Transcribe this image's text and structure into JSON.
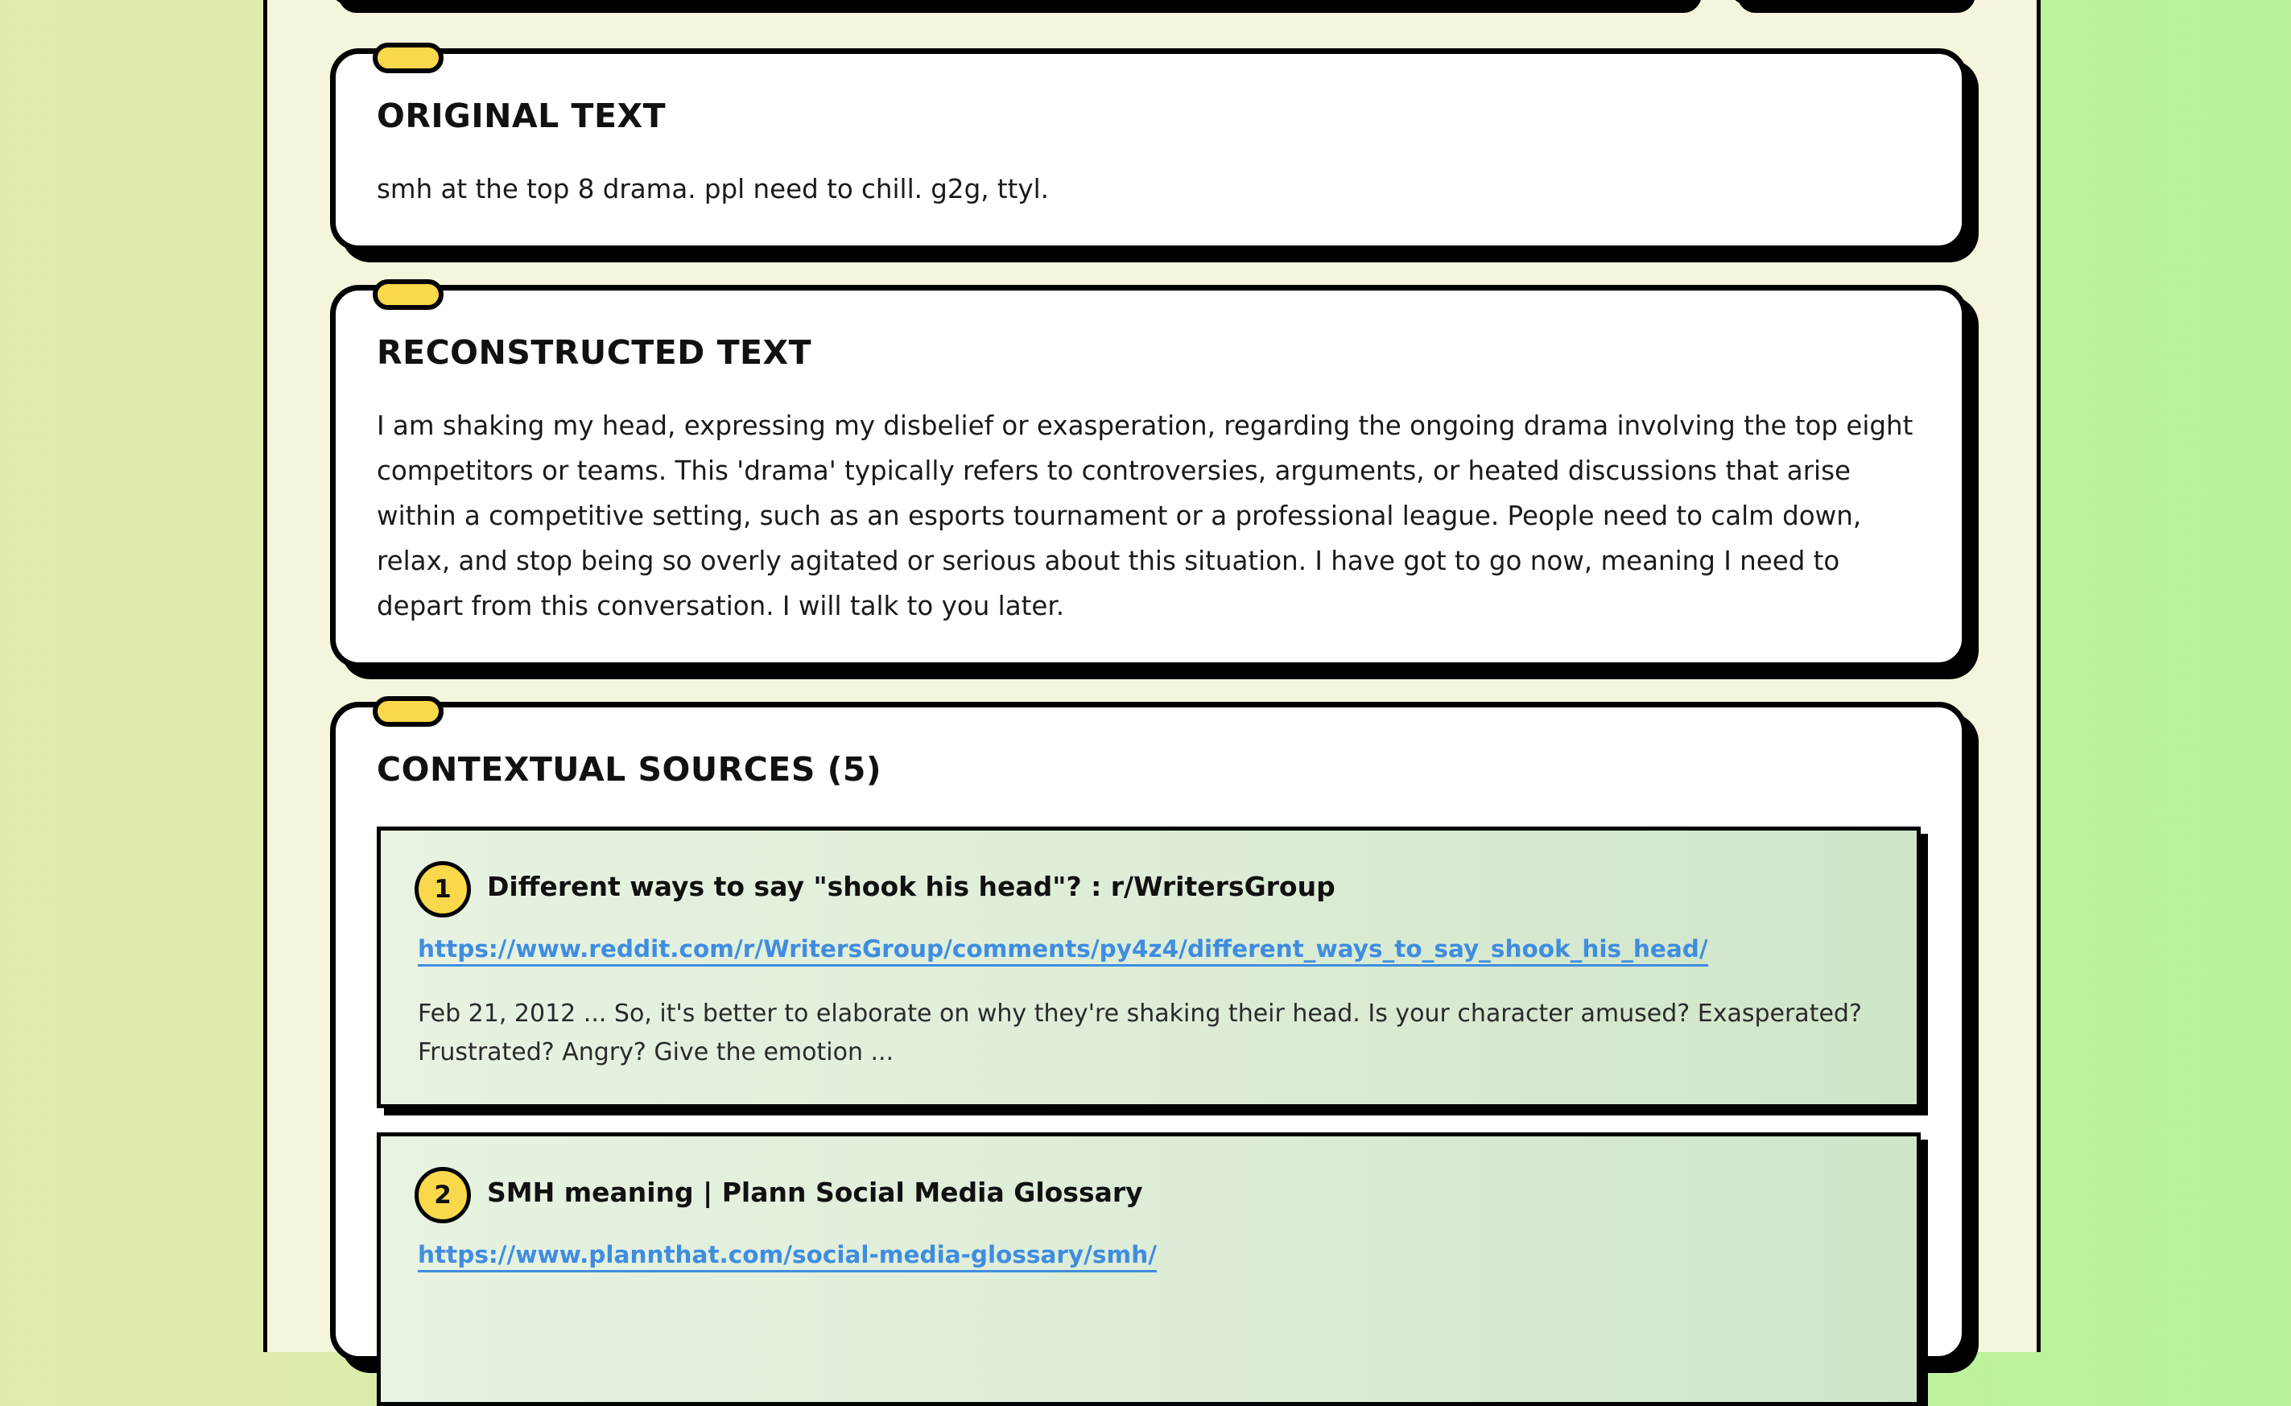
{
  "original_card": {
    "title": "ORIGINAL TEXT",
    "text": "smh at the top 8 drama. ppl need to chill. g2g, ttyl."
  },
  "reconstructed_card": {
    "title": "RECONSTRUCTED TEXT",
    "text": "I am shaking my head, expressing my disbelief or exasperation, regarding the ongoing drama involving the top eight competitors or teams. This 'drama' typically refers to controversies, arguments, or heated discussions that arise within a competitive setting, such as an esports tournament or a professional league. People need to calm down, relax, and stop being so overly agitated or serious about this situation. I have got to go now, meaning I need to depart from this conversation. I will talk to you later."
  },
  "sources_card": {
    "title": "CONTEXTUAL SOURCES (5)",
    "sources": [
      {
        "number": "1",
        "title": "Different ways to say \"shook his head\"? : r/WritersGroup",
        "url": "https://www.reddit.com/r/WritersGroup/comments/py4z4/different_ways_to_say_shook_his_head/",
        "snippet": "Feb 21, 2012 ... So, it's better to elaborate on why they're shaking their head. Is your character amused? Exasperated? Frustrated? Angry? Give the emotion ..."
      },
      {
        "number": "2",
        "title": "SMH meaning | Plann Social Media Glossary",
        "url": "https://www.plannthat.com/social-media-glossary/smh/"
      }
    ]
  },
  "colors": {
    "accent_yellow": "#fad84b",
    "link_blue": "#3f8de0",
    "panel_cream": "#f4f5dc"
  }
}
